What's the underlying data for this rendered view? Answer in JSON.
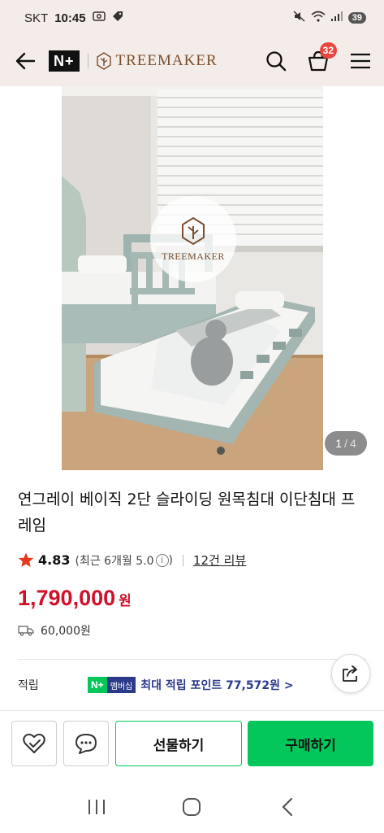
{
  "status_bar": {
    "carrier": "SKT",
    "time": "10:45",
    "battery": "39"
  },
  "header": {
    "nplus_logo": "N+",
    "brand_name": "TREEMAKER",
    "cart_count": "32"
  },
  "gallery": {
    "watermark_text": "TREEMAKER",
    "current_page": "1",
    "total_pages": "4"
  },
  "product": {
    "title": "연그레이 베이직 2단 슬라이딩 원목침대 이단침대 프레임",
    "rating": "4.83",
    "rating_sub": "(최근 6개월 5.0",
    "rating_sub_close": ")",
    "review_link": "12건 리뷰",
    "price": "1,790,000",
    "currency": "원",
    "shipping_fee": "60,000원"
  },
  "points": {
    "label": "적립",
    "badge_n": "N+",
    "badge_membership": "멤버십",
    "text": "최대 적립 포인트 77,572원 >"
  },
  "actions": {
    "gift_label": "선물하기",
    "buy_label": "구매하기"
  },
  "colors": {
    "header_bg": "#f4ece8",
    "brand_brown": "#7a4e2f",
    "price_red": "#d1102a",
    "naver_green": "#03c75a",
    "membership_navy": "#2b3a8b",
    "star_red": "#e8371f"
  }
}
